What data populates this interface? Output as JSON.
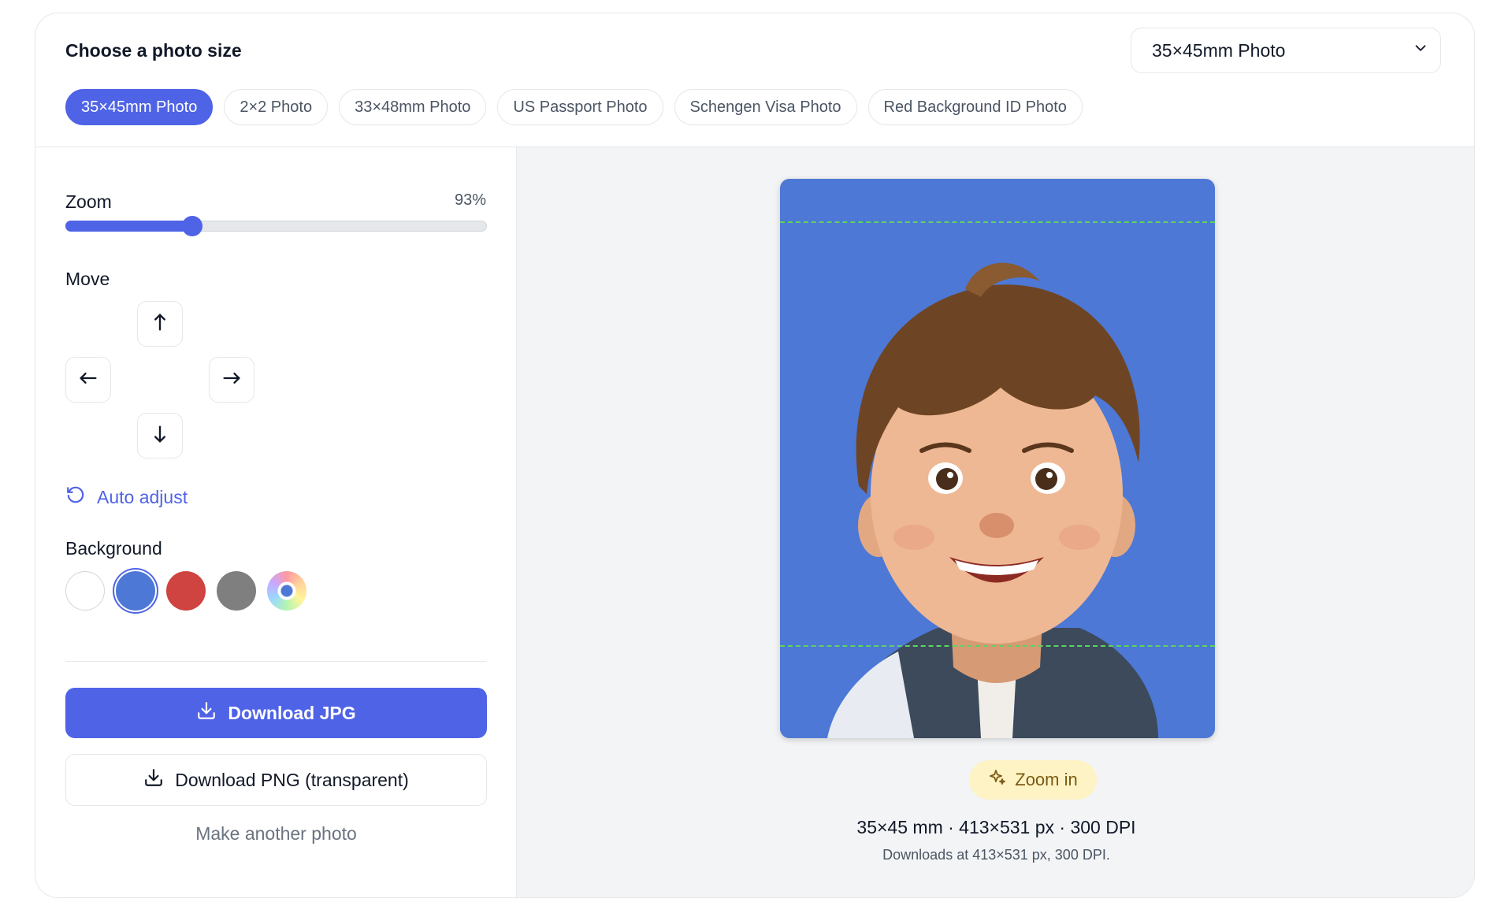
{
  "header": {
    "title": "Choose a photo size",
    "selected_size": "35×45mm Photo",
    "sizes": [
      {
        "label": "35×45mm Photo",
        "active": true
      },
      {
        "label": "2×2 Photo",
        "active": false
      },
      {
        "label": "33×48mm Photo",
        "active": false
      },
      {
        "label": "US Passport Photo",
        "active": false
      },
      {
        "label": "Schengen Visa Photo",
        "active": false
      },
      {
        "label": "Red Background ID Photo",
        "active": false
      }
    ]
  },
  "controls": {
    "zoom_label": "Zoom",
    "zoom_value": "93%",
    "zoom_level": 0.3,
    "move_label": "Move",
    "move_icons": [
      "arrow-up-icon",
      "arrow-left-icon",
      "arrow-right-icon",
      "arrow-down-icon"
    ],
    "auto_adjust": "Auto adjust",
    "background_label": "Background",
    "backgrounds": [
      {
        "name": "white",
        "color": "#ffffff",
        "selected": false
      },
      {
        "name": "blue",
        "color": "#4d78d6",
        "selected": true
      },
      {
        "name": "red",
        "color": "#cf4340",
        "selected": false
      },
      {
        "name": "gray",
        "color": "#7f7f7f",
        "selected": false
      },
      {
        "name": "custom",
        "color": "custom",
        "selected": false
      }
    ],
    "download_jpg": "Download JPG",
    "download_png": "Download PNG (transparent)",
    "make_another": "Make another photo"
  },
  "preview": {
    "background_color": "#4d78d6",
    "zoom_in": "Zoom in",
    "spec": "35×45 mm · 413×531 px · 300 DPI",
    "download_info": "Downloads at 413×531 px, 300 DPI."
  },
  "colors": {
    "accent": "#4f63e6",
    "guide": "#5fd35f",
    "zoom_in_bg": "#fdf3c5"
  }
}
